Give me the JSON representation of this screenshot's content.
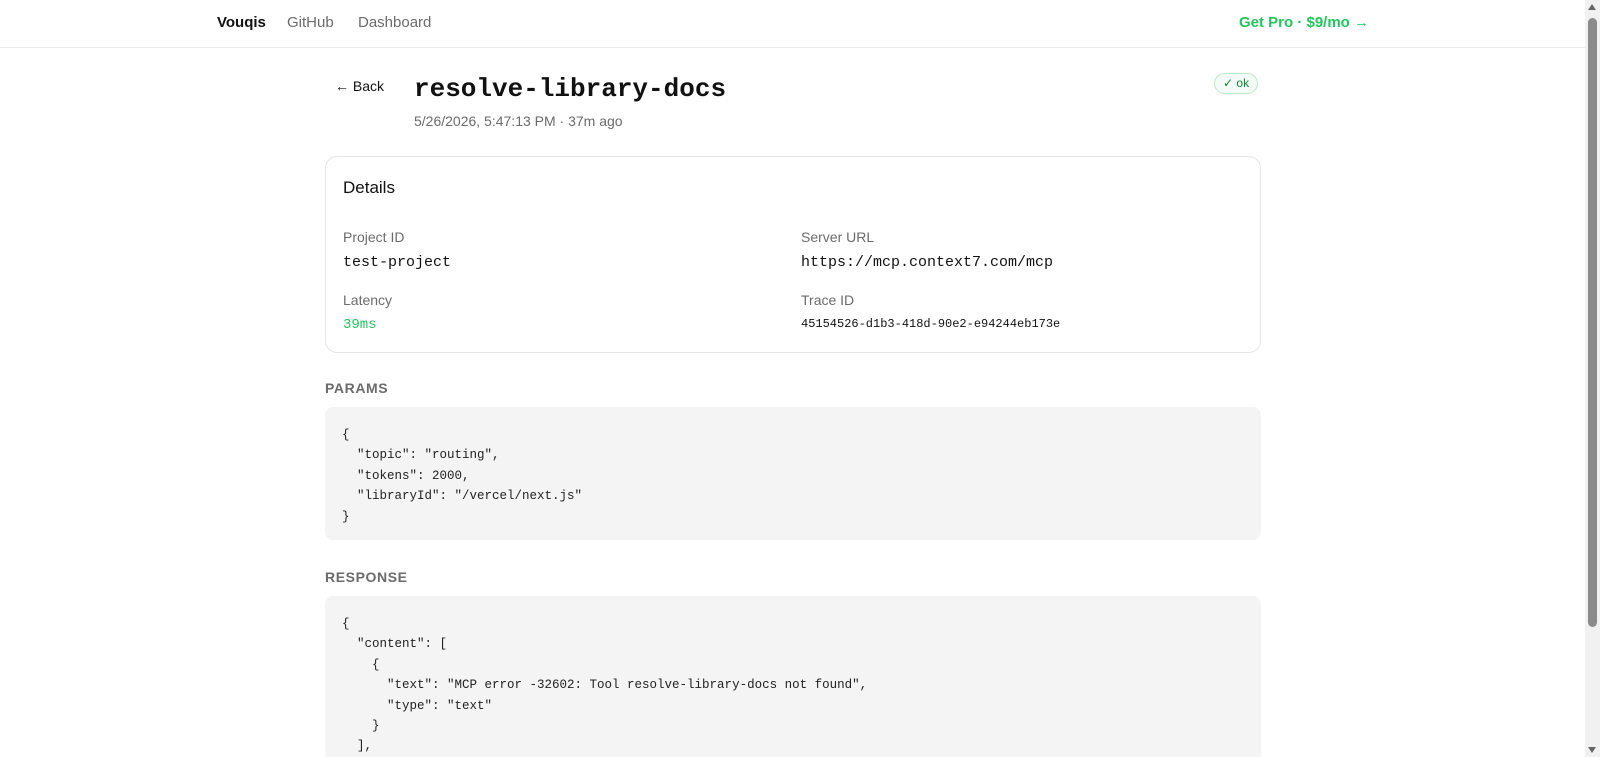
{
  "header": {
    "brand": "Vouqis",
    "nav": [
      "GitHub",
      "Dashboard"
    ],
    "cta": "Get Pro · $9/mo →",
    "accent_color": "#22c55e"
  },
  "page": {
    "back_label": "← Back",
    "title": "resolve-library-docs",
    "subtitle": "5/26/2026, 5:47:13 PM · 37m ago",
    "status_badge": "✓ ok"
  },
  "details": {
    "heading": "Details",
    "project_id_label": "Project ID",
    "project_id": "test-project",
    "server_url_label": "Server URL",
    "server_url": "https://mcp.context7.com/mcp",
    "latency_label": "Latency",
    "latency": "39ms",
    "trace_id_label": "Trace ID",
    "trace_id": "45154526-d1b3-418d-90e2-e94244eb173e"
  },
  "params": {
    "label": "PARAMS",
    "code": "{\n  \"topic\": \"routing\",\n  \"tokens\": 2000,\n  \"libraryId\": \"/vercel/next.js\"\n}"
  },
  "response": {
    "label": "RESPONSE",
    "code": "{\n  \"content\": [\n    {\n      \"text\": \"MCP error -32602: Tool resolve-library-docs not found\",\n      \"type\": \"text\"\n    }\n  ],"
  }
}
